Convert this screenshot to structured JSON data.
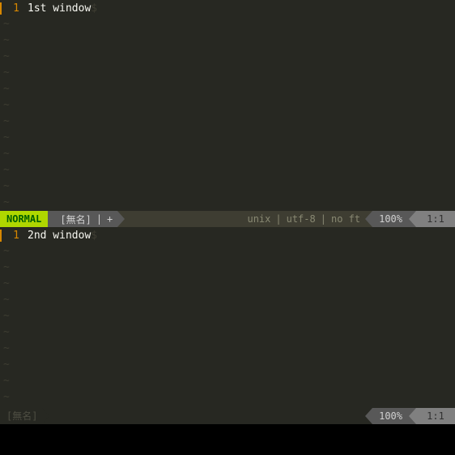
{
  "panes": [
    {
      "active": true,
      "line_number": "1",
      "text": "1st window",
      "eol": "$",
      "status": {
        "mode": "NORMAL",
        "filename": "[無名]",
        "modified": "+",
        "fileformat": "unix",
        "encoding": "utf-8",
        "filetype": "no ft",
        "percent": "100%",
        "position": "1:1"
      }
    },
    {
      "active": false,
      "line_number": "1",
      "text": "2nd window",
      "eol": "$",
      "status": {
        "filename": "[無名]",
        "percent": "100%",
        "position": "1:1"
      }
    }
  ],
  "separator": "|"
}
